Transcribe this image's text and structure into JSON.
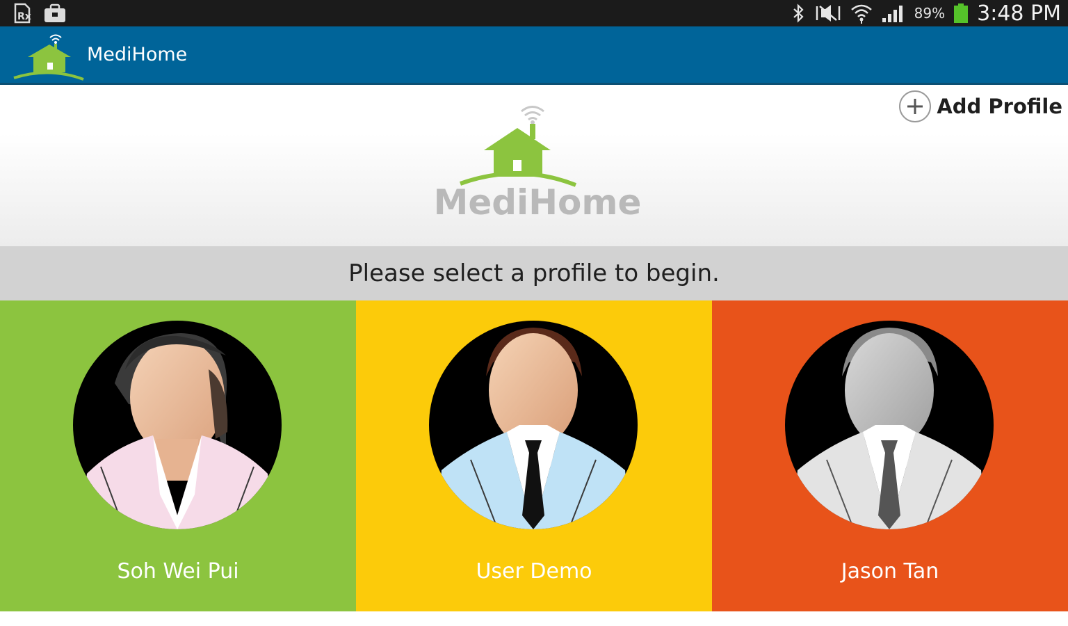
{
  "status_bar": {
    "battery_percent": "89%",
    "time": "3:48 PM",
    "icons": [
      "prescription-notification-icon",
      "briefcase-notification-icon",
      "bluetooth-icon",
      "mute-icon",
      "wifi-icon",
      "signal-icon",
      "battery-icon"
    ]
  },
  "action_bar": {
    "title": "MediHome",
    "background": "#006499"
  },
  "header": {
    "add_profile_label": "Add Profile",
    "brand_name": "MediHome"
  },
  "prompt": "Please select a profile to begin.",
  "profiles": [
    {
      "name": "Soh Wei Pui",
      "color": "#8cc43f",
      "avatar": "female-avatar"
    },
    {
      "name": "User Demo",
      "color": "#fccb0a",
      "avatar": "male-avatar-color"
    },
    {
      "name": "Jason Tan",
      "color": "#e8531a",
      "avatar": "male-avatar-grey"
    }
  ]
}
